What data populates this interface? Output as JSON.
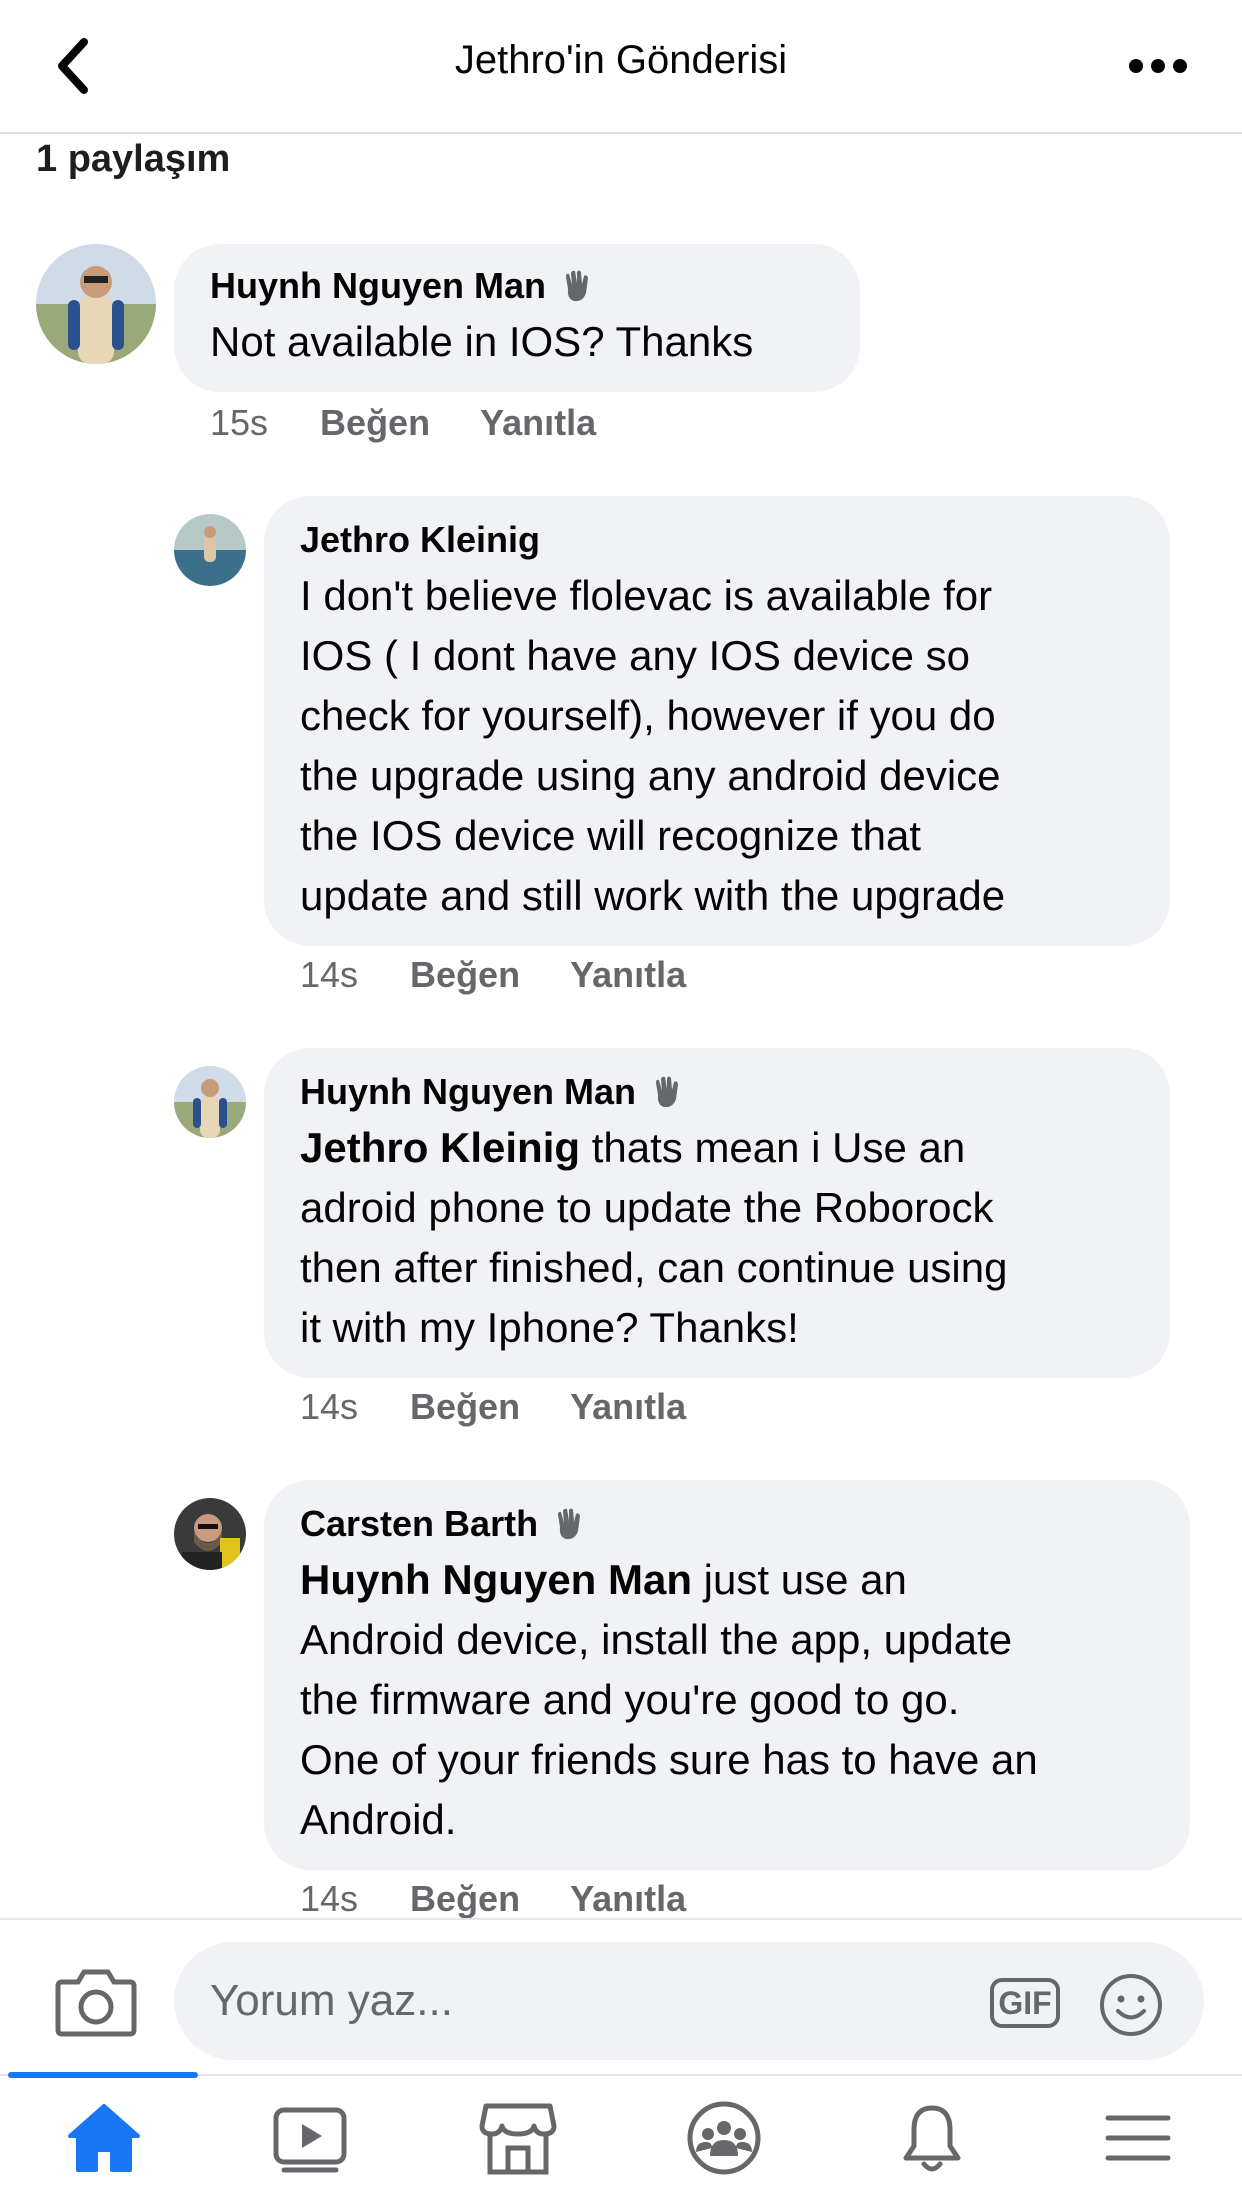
{
  "header": {
    "title": "Jethro'in Gönderisi"
  },
  "shares": "1 paylaşım",
  "comments": [
    {
      "author": "Huynh Nguyen Man",
      "mention": "",
      "text": "Not available in IOS? Thanks",
      "time": "15s",
      "like": "Beğen",
      "reply": "Yanıtla"
    },
    {
      "author": "Jethro Kleinig",
      "mention": "",
      "lines": [
        "I don't believe flolevac is available for",
        "IOS ( I dont have any IOS device so",
        "check for yourself), however if you do",
        "the upgrade using any android device",
        "the IOS device will recognize that",
        "update and still work with the upgrade"
      ],
      "time": "14s",
      "like": "Beğen",
      "reply": "Yanıtla"
    },
    {
      "author": "Huynh Nguyen Man",
      "mention": "Jethro Kleinig",
      "lines": [
        " thats mean i Use an",
        "adroid phone to update the Roborock",
        "then after finished, can continue using",
        "it with my Iphone? Thanks!"
      ],
      "time": "14s",
      "like": "Beğen",
      "reply": "Yanıtla"
    },
    {
      "author": "Carsten Barth",
      "mention": "Huynh Nguyen Man",
      "lines": [
        " just use an",
        "Android device, install the app, update",
        "the firmware and you're good to go.",
        "One of your friends sure has to have an",
        "Android."
      ],
      "time": "14s",
      "like": "Beğen",
      "reply": "Yanıtla"
    }
  ],
  "composer": {
    "placeholder": "Yorum yaz...",
    "gif_label": "GIF"
  },
  "tabs": [
    "home-icon",
    "watch-icon",
    "marketplace-icon",
    "groups-icon",
    "notifications-icon",
    "menu-icon"
  ],
  "colors": {
    "accent": "#1877f2",
    "bubble": "#f0f2f5",
    "meta": "#65676b"
  }
}
